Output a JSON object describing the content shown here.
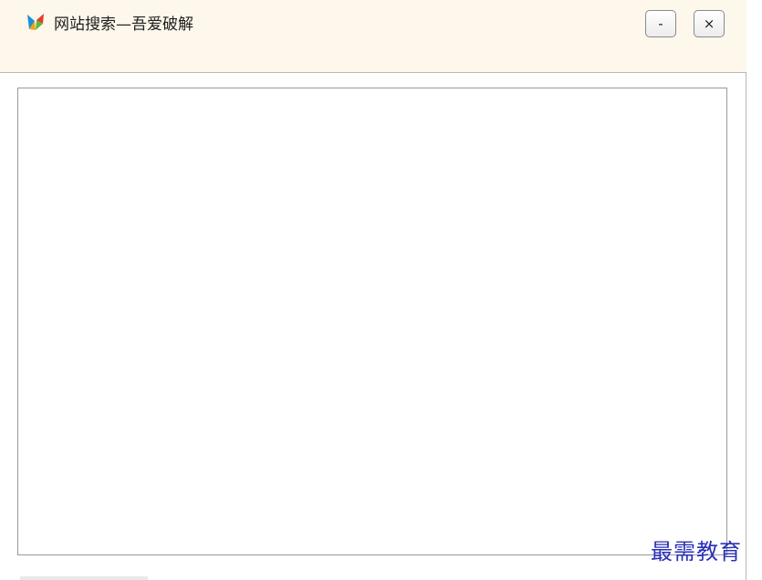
{
  "window": {
    "title": "网站搜索—吾爱破解",
    "minimize_label": "-",
    "close_label": "×",
    "icon": "app-butterfly-icon"
  },
  "watermark": {
    "text": "最需教育"
  },
  "colors": {
    "titlebar_bg": "#fdf7ec",
    "frame_border": "#9a9a9a",
    "watermark": "#2a2fb8"
  }
}
